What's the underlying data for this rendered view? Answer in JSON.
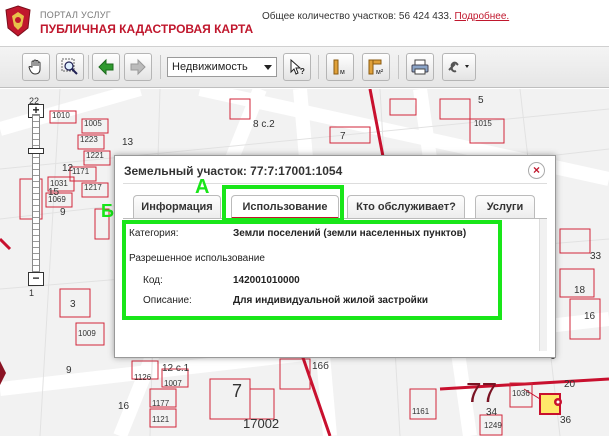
{
  "header": {
    "portal_subtitle": "ПОРТАЛ УСЛУГ",
    "portal_title": "ПУБЛИЧНАЯ КАДАСТРОВАЯ КАРТА",
    "count_text": "Общее количество участков: 56 424 433.",
    "more_link": "Подробнее."
  },
  "toolbar": {
    "layer_select": "Недвижимость",
    "buttons": [
      "hand-icon",
      "zoom-rect-icon",
      "back-arrow-icon",
      "forward-arrow-icon",
      "identify-icon",
      "measure-length-icon",
      "measure-area-icon",
      "print-icon",
      "link-icon"
    ]
  },
  "zoom": {
    "top_label": "22",
    "bottom_label": "1"
  },
  "map": {
    "labels": [
      {
        "t": "1010"
      },
      {
        "t": "1005"
      },
      {
        "t": "1223"
      },
      {
        "t": "1221"
      },
      {
        "t": "1171"
      },
      {
        "t": "1217"
      },
      {
        "t": "1031"
      },
      {
        "t": "1069"
      },
      {
        "t": "13"
      },
      {
        "t": "12"
      },
      {
        "t": "15"
      },
      {
        "t": "9"
      },
      {
        "t": "8 с.2"
      },
      {
        "t": "7"
      },
      {
        "t": "1015"
      },
      {
        "t": "5"
      },
      {
        "t": "33"
      },
      {
        "t": "18"
      },
      {
        "t": "16"
      },
      {
        "t": "3"
      },
      {
        "t": "1009"
      },
      {
        "t": "9"
      },
      {
        "t": "12 с.1"
      },
      {
        "t": "1126"
      },
      {
        "t": "1007"
      },
      {
        "t": "1177"
      },
      {
        "t": "1121"
      },
      {
        "t": "7"
      },
      {
        "t": "16б"
      },
      {
        "t": "16"
      },
      {
        "t": "17002"
      },
      {
        "t": "77"
      },
      {
        "t": "1161"
      },
      {
        "t": "1036"
      },
      {
        "t": "1249"
      },
      {
        "t": "34"
      },
      {
        "t": "36"
      },
      {
        "t": "20"
      },
      {
        "t": "6"
      },
      {
        "t": "Б"
      }
    ]
  },
  "popup": {
    "title": "Земельный участок: 77:7:17001:1054",
    "tabs": [
      {
        "label": "Информация"
      },
      {
        "label": "Использование"
      },
      {
        "label": "Кто обслуживает?"
      },
      {
        "label": "Услуги"
      }
    ],
    "category_label": "Категория:",
    "category_value": "Земли поселений (земли населенных пунктов)",
    "permitted_use_label": "Разрешенное использование",
    "code_label": "Код:",
    "code_value": "142001010000",
    "description_label": "Описание:",
    "description_value": "Для индивидуальной жилой застройки"
  },
  "annotations": {
    "a": "А",
    "b": "Б"
  },
  "colors": {
    "brand": "#c0172d",
    "highlight": "#19e619"
  }
}
